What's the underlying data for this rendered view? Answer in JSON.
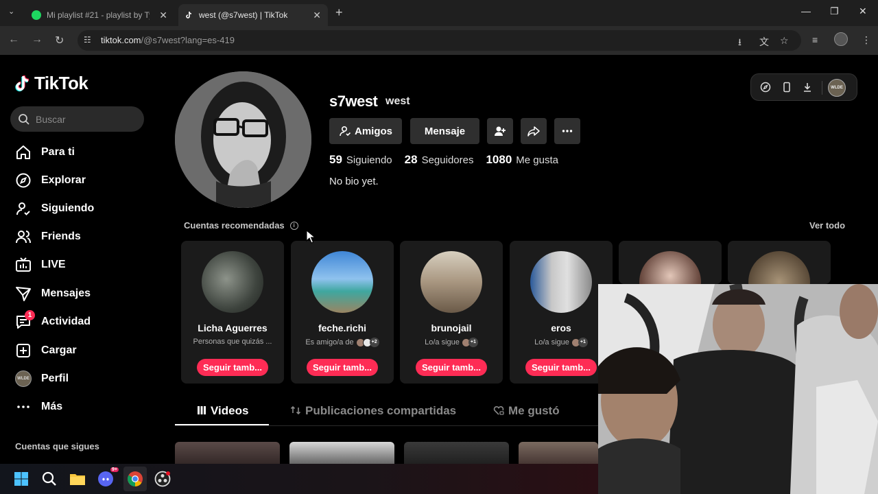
{
  "browser": {
    "tabs": [
      {
        "title": "Mi playlist #21 - playlist by Tyra",
        "favicon": "spotify-icon"
      },
      {
        "title": "west (@s7west) | TikTok",
        "favicon": "tiktok-icon"
      }
    ],
    "url_host": "tiktok.com",
    "url_path": "/@s7west?lang=es-419"
  },
  "sidebar": {
    "logo": "TikTok",
    "search_placeholder": "Buscar",
    "items": [
      {
        "label": "Para ti",
        "icon": "home-icon"
      },
      {
        "label": "Explorar",
        "icon": "compass-icon"
      },
      {
        "label": "Siguiendo",
        "icon": "following-icon"
      },
      {
        "label": "Friends",
        "icon": "friends-icon"
      },
      {
        "label": "LIVE",
        "icon": "live-icon"
      },
      {
        "label": "Mensajes",
        "icon": "messages-icon"
      },
      {
        "label": "Actividad",
        "icon": "activity-icon",
        "badge": "1"
      },
      {
        "label": "Cargar",
        "icon": "upload-icon"
      },
      {
        "label": "Perfil",
        "icon": "profile-avatar"
      },
      {
        "label": "Más",
        "icon": "more-icon"
      }
    ],
    "follows_title": "Cuentas que sigues",
    "avatar_text": "WLDE"
  },
  "profile": {
    "username": "s7west",
    "nickname": "west",
    "buttons": {
      "friends": "Amigos",
      "message": "Mensaje"
    },
    "stats": {
      "following_count": "59",
      "following_label": "Siguiendo",
      "followers_count": "28",
      "followers_label": "Seguidores",
      "likes_count": "1080",
      "likes_label": "Me gusta"
    },
    "bio": "No bio yet."
  },
  "recommended": {
    "title": "Cuentas recomendadas",
    "see_all": "Ver todo",
    "cards": [
      {
        "name": "Licha Aguerres",
        "sub": "Personas que quizás ...",
        "button": "Seguir tamb...",
        "mutual": ""
      },
      {
        "name": "feche.richi",
        "sub": "Es amigo/a de",
        "button": "Seguir tamb...",
        "mutual": "+2"
      },
      {
        "name": "brunojail",
        "sub": "Lo/a sigue",
        "button": "Seguir tamb...",
        "mutual": "+1"
      },
      {
        "name": "eros",
        "sub": "Lo/a sigue",
        "button": "Seguir tamb...",
        "mutual": "+1"
      }
    ]
  },
  "content_tabs": {
    "videos": "Videos",
    "reposts": "Publicaciones compartidas",
    "liked": "Me gustó"
  },
  "taskbar": {
    "discord_badge": "9+"
  },
  "colors": {
    "accent": "#fe2c55",
    "background": "#000000",
    "button_bg": "#2f2f2f"
  }
}
